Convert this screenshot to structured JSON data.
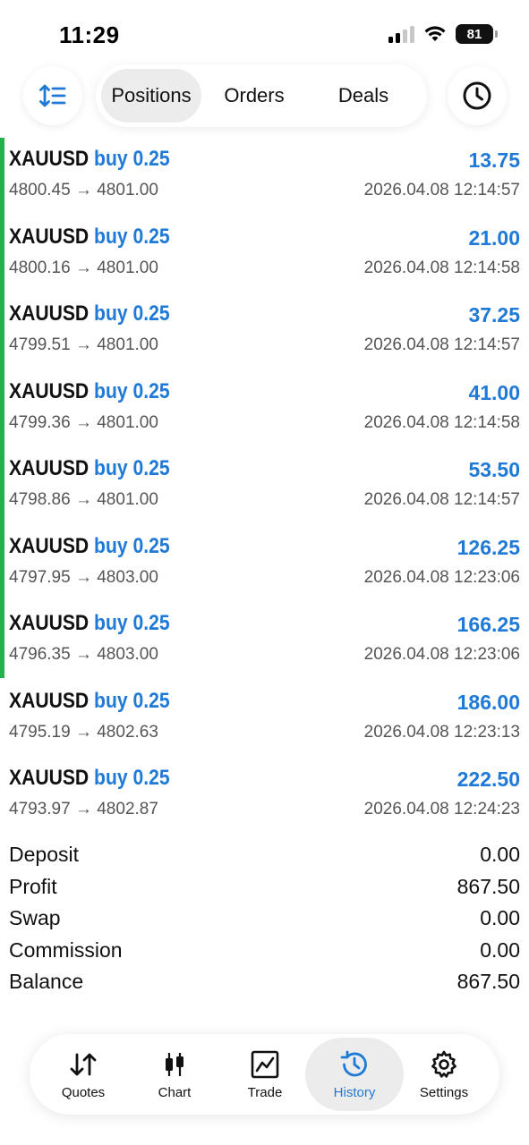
{
  "status": {
    "time": "11:29",
    "battery": "81"
  },
  "toolbar": {
    "tabs": [
      {
        "label": "Positions",
        "active": true
      },
      {
        "label": "Orders",
        "active": false
      },
      {
        "label": "Deals",
        "active": false
      }
    ]
  },
  "deals": [
    {
      "symbol": "XAUUSD",
      "type": "buy 0.25",
      "prices": "4800.45 → 4801.00",
      "profit": "13.75",
      "time": "2026.04.08 12:14:57"
    },
    {
      "symbol": "XAUUSD",
      "type": "buy 0.25",
      "prices": "4800.16 → 4801.00",
      "profit": "21.00",
      "time": "2026.04.08 12:14:58"
    },
    {
      "symbol": "XAUUSD",
      "type": "buy 0.25",
      "prices": "4799.51 → 4801.00",
      "profit": "37.25",
      "time": "2026.04.08 12:14:57"
    },
    {
      "symbol": "XAUUSD",
      "type": "buy 0.25",
      "prices": "4799.36 → 4801.00",
      "profit": "41.00",
      "time": "2026.04.08 12:14:58"
    },
    {
      "symbol": "XAUUSD",
      "type": "buy 0.25",
      "prices": "4798.86 → 4801.00",
      "profit": "53.50",
      "time": "2026.04.08 12:14:57"
    },
    {
      "symbol": "XAUUSD",
      "type": "buy 0.25",
      "prices": "4797.95 → 4803.00",
      "profit": "126.25",
      "time": "2026.04.08 12:23:06"
    },
    {
      "symbol": "XAUUSD",
      "type": "buy 0.25",
      "prices": "4796.35 → 4803.00",
      "profit": "166.25",
      "time": "2026.04.08 12:23:06"
    },
    {
      "symbol": "XAUUSD",
      "type": "buy 0.25",
      "prices": "4795.19 → 4802.63",
      "profit": "186.00",
      "time": "2026.04.08 12:23:13"
    },
    {
      "symbol": "XAUUSD",
      "type": "buy 0.25",
      "prices": "4793.97 → 4802.87",
      "profit": "222.50",
      "time": "2026.04.08 12:24:23"
    }
  ],
  "summary": [
    {
      "label": "Deposit",
      "value": "0.00"
    },
    {
      "label": "Profit",
      "value": "867.50"
    },
    {
      "label": "Swap",
      "value": "0.00"
    },
    {
      "label": "Commission",
      "value": "0.00"
    },
    {
      "label": "Balance",
      "value": "867.50"
    }
  ],
  "tabbar": {
    "tabs": [
      {
        "label": "Quotes",
        "icon": "quotes-icon",
        "active": false
      },
      {
        "label": "Chart",
        "icon": "candlestick-icon",
        "active": false
      },
      {
        "label": "Trade",
        "icon": "trade-chart-icon",
        "active": false
      },
      {
        "label": "History",
        "icon": "history-icon",
        "active": true
      },
      {
        "label": "Settings",
        "icon": "gear-icon",
        "active": false
      }
    ]
  },
  "colors": {
    "accent": "#1e7ad6",
    "highlight_bar": "#22b14c"
  }
}
